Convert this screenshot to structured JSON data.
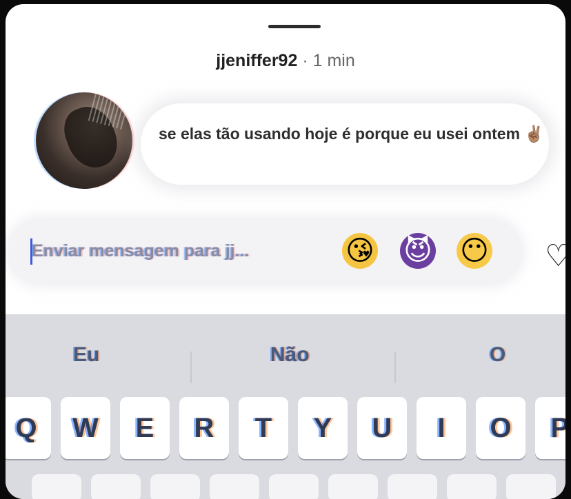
{
  "header": {
    "username": "jjeniffer92",
    "separator": "·",
    "time": "1 min"
  },
  "story_reply": {
    "message": "se elas tão usando hoje é porque eu usei ontem ✌🏽"
  },
  "composer": {
    "placeholder": "Enviar mensagem para jj...",
    "quick_reactions": [
      "😘",
      "😈",
      "😶"
    ],
    "like_icon": "heart-outline-icon"
  },
  "keyboard": {
    "suggestions": [
      "Eu",
      "Não",
      "O"
    ],
    "row1": [
      "Q",
      "W",
      "E",
      "R",
      "T",
      "Y",
      "U",
      "I",
      "O",
      "P"
    ]
  }
}
